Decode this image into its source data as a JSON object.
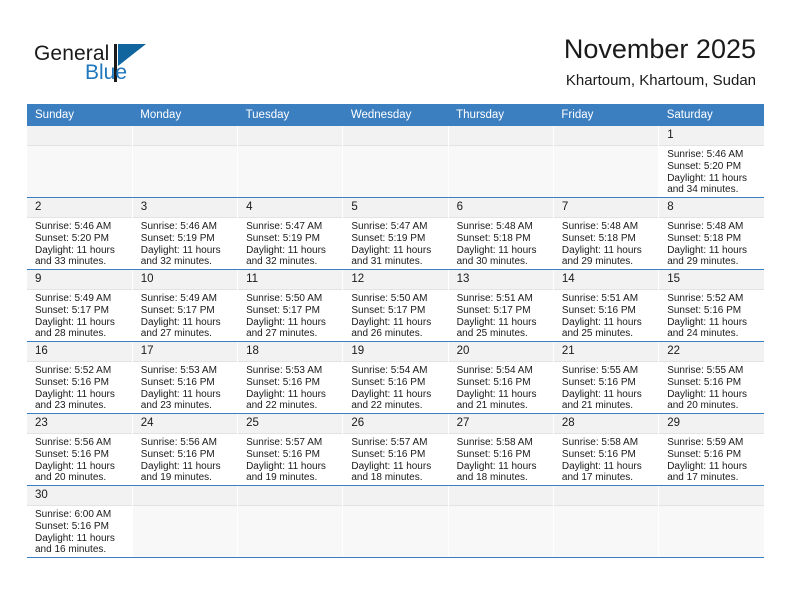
{
  "brand": {
    "name_top": "General",
    "name_bottom": "Blue",
    "accent_color": "#1f77be",
    "mark_color": "#10659f"
  },
  "header": {
    "month_title": "November 2025",
    "location": "Khartoum, Khartoum, Sudan"
  },
  "calendar": {
    "header_color": "#3c7fc0",
    "daynum_bg": "#f2f2f2",
    "weekdays": [
      "Sunday",
      "Monday",
      "Tuesday",
      "Wednesday",
      "Thursday",
      "Friday",
      "Saturday"
    ],
    "labels": {
      "sunrise": "Sunrise:",
      "sunset": "Sunset:",
      "daylight": "Daylight:"
    },
    "weeks": [
      [
        {
          "blank": true
        },
        {
          "blank": true
        },
        {
          "blank": true
        },
        {
          "blank": true
        },
        {
          "blank": true
        },
        {
          "blank": true
        },
        {
          "day": "1",
          "sunrise": "Sunrise: 5:46 AM",
          "sunset": "Sunset: 5:20 PM",
          "daylight1": "Daylight: 11 hours",
          "daylight2": "and 34 minutes."
        }
      ],
      [
        {
          "day": "2",
          "sunrise": "Sunrise: 5:46 AM",
          "sunset": "Sunset: 5:20 PM",
          "daylight1": "Daylight: 11 hours",
          "daylight2": "and 33 minutes."
        },
        {
          "day": "3",
          "sunrise": "Sunrise: 5:46 AM",
          "sunset": "Sunset: 5:19 PM",
          "daylight1": "Daylight: 11 hours",
          "daylight2": "and 32 minutes."
        },
        {
          "day": "4",
          "sunrise": "Sunrise: 5:47 AM",
          "sunset": "Sunset: 5:19 PM",
          "daylight1": "Daylight: 11 hours",
          "daylight2": "and 32 minutes."
        },
        {
          "day": "5",
          "sunrise": "Sunrise: 5:47 AM",
          "sunset": "Sunset: 5:19 PM",
          "daylight1": "Daylight: 11 hours",
          "daylight2": "and 31 minutes."
        },
        {
          "day": "6",
          "sunrise": "Sunrise: 5:48 AM",
          "sunset": "Sunset: 5:18 PM",
          "daylight1": "Daylight: 11 hours",
          "daylight2": "and 30 minutes."
        },
        {
          "day": "7",
          "sunrise": "Sunrise: 5:48 AM",
          "sunset": "Sunset: 5:18 PM",
          "daylight1": "Daylight: 11 hours",
          "daylight2": "and 29 minutes."
        },
        {
          "day": "8",
          "sunrise": "Sunrise: 5:48 AM",
          "sunset": "Sunset: 5:18 PM",
          "daylight1": "Daylight: 11 hours",
          "daylight2": "and 29 minutes."
        }
      ],
      [
        {
          "day": "9",
          "sunrise": "Sunrise: 5:49 AM",
          "sunset": "Sunset: 5:17 PM",
          "daylight1": "Daylight: 11 hours",
          "daylight2": "and 28 minutes."
        },
        {
          "day": "10",
          "sunrise": "Sunrise: 5:49 AM",
          "sunset": "Sunset: 5:17 PM",
          "daylight1": "Daylight: 11 hours",
          "daylight2": "and 27 minutes."
        },
        {
          "day": "11",
          "sunrise": "Sunrise: 5:50 AM",
          "sunset": "Sunset: 5:17 PM",
          "daylight1": "Daylight: 11 hours",
          "daylight2": "and 27 minutes."
        },
        {
          "day": "12",
          "sunrise": "Sunrise: 5:50 AM",
          "sunset": "Sunset: 5:17 PM",
          "daylight1": "Daylight: 11 hours",
          "daylight2": "and 26 minutes."
        },
        {
          "day": "13",
          "sunrise": "Sunrise: 5:51 AM",
          "sunset": "Sunset: 5:17 PM",
          "daylight1": "Daylight: 11 hours",
          "daylight2": "and 25 minutes."
        },
        {
          "day": "14",
          "sunrise": "Sunrise: 5:51 AM",
          "sunset": "Sunset: 5:16 PM",
          "daylight1": "Daylight: 11 hours",
          "daylight2": "and 25 minutes."
        },
        {
          "day": "15",
          "sunrise": "Sunrise: 5:52 AM",
          "sunset": "Sunset: 5:16 PM",
          "daylight1": "Daylight: 11 hours",
          "daylight2": "and 24 minutes."
        }
      ],
      [
        {
          "day": "16",
          "sunrise": "Sunrise: 5:52 AM",
          "sunset": "Sunset: 5:16 PM",
          "daylight1": "Daylight: 11 hours",
          "daylight2": "and 23 minutes."
        },
        {
          "day": "17",
          "sunrise": "Sunrise: 5:53 AM",
          "sunset": "Sunset: 5:16 PM",
          "daylight1": "Daylight: 11 hours",
          "daylight2": "and 23 minutes."
        },
        {
          "day": "18",
          "sunrise": "Sunrise: 5:53 AM",
          "sunset": "Sunset: 5:16 PM",
          "daylight1": "Daylight: 11 hours",
          "daylight2": "and 22 minutes."
        },
        {
          "day": "19",
          "sunrise": "Sunrise: 5:54 AM",
          "sunset": "Sunset: 5:16 PM",
          "daylight1": "Daylight: 11 hours",
          "daylight2": "and 22 minutes."
        },
        {
          "day": "20",
          "sunrise": "Sunrise: 5:54 AM",
          "sunset": "Sunset: 5:16 PM",
          "daylight1": "Daylight: 11 hours",
          "daylight2": "and 21 minutes."
        },
        {
          "day": "21",
          "sunrise": "Sunrise: 5:55 AM",
          "sunset": "Sunset: 5:16 PM",
          "daylight1": "Daylight: 11 hours",
          "daylight2": "and 21 minutes."
        },
        {
          "day": "22",
          "sunrise": "Sunrise: 5:55 AM",
          "sunset": "Sunset: 5:16 PM",
          "daylight1": "Daylight: 11 hours",
          "daylight2": "and 20 minutes."
        }
      ],
      [
        {
          "day": "23",
          "sunrise": "Sunrise: 5:56 AM",
          "sunset": "Sunset: 5:16 PM",
          "daylight1": "Daylight: 11 hours",
          "daylight2": "and 20 minutes."
        },
        {
          "day": "24",
          "sunrise": "Sunrise: 5:56 AM",
          "sunset": "Sunset: 5:16 PM",
          "daylight1": "Daylight: 11 hours",
          "daylight2": "and 19 minutes."
        },
        {
          "day": "25",
          "sunrise": "Sunrise: 5:57 AM",
          "sunset": "Sunset: 5:16 PM",
          "daylight1": "Daylight: 11 hours",
          "daylight2": "and 19 minutes."
        },
        {
          "day": "26",
          "sunrise": "Sunrise: 5:57 AM",
          "sunset": "Sunset: 5:16 PM",
          "daylight1": "Daylight: 11 hours",
          "daylight2": "and 18 minutes."
        },
        {
          "day": "27",
          "sunrise": "Sunrise: 5:58 AM",
          "sunset": "Sunset: 5:16 PM",
          "daylight1": "Daylight: 11 hours",
          "daylight2": "and 18 minutes."
        },
        {
          "day": "28",
          "sunrise": "Sunrise: 5:58 AM",
          "sunset": "Sunset: 5:16 PM",
          "daylight1": "Daylight: 11 hours",
          "daylight2": "and 17 minutes."
        },
        {
          "day": "29",
          "sunrise": "Sunrise: 5:59 AM",
          "sunset": "Sunset: 5:16 PM",
          "daylight1": "Daylight: 11 hours",
          "daylight2": "and 17 minutes."
        }
      ],
      [
        {
          "day": "30",
          "sunrise": "Sunrise: 6:00 AM",
          "sunset": "Sunset: 5:16 PM",
          "daylight1": "Daylight: 11 hours",
          "daylight2": "and 16 minutes."
        },
        {
          "blank": true
        },
        {
          "blank": true
        },
        {
          "blank": true
        },
        {
          "blank": true
        },
        {
          "blank": true
        },
        {
          "blank": true
        }
      ]
    ]
  }
}
